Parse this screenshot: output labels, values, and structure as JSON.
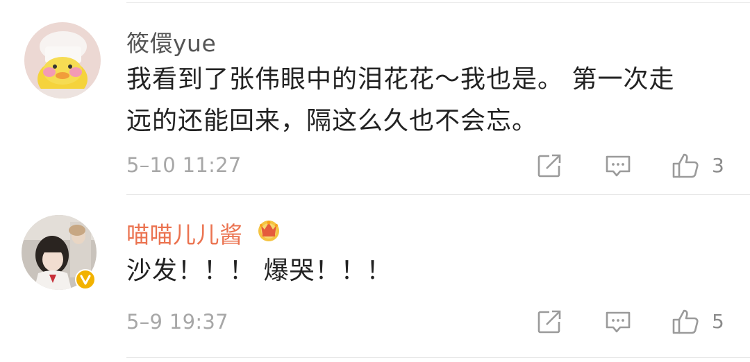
{
  "comments": [
    {
      "username": "筱儇yue",
      "avatar": "duck-with-chef-hat-avatar",
      "line1": "我看到了张伟眼中的泪花花～我也是。 第一次走",
      "line2": "远的还能回来，隔这么久也不会忘。",
      "timestamp": "5–10 11:27",
      "likes": "3",
      "icons": [
        "share-icon",
        "comment-icon",
        "like-icon"
      ]
    },
    {
      "username": "喵喵儿儿酱",
      "avatar": "girl-photo-avatar",
      "badges": [
        "crown-icon",
        "verified-icon"
      ],
      "line1": "沙发！！！ 爆哭！！！",
      "timestamp": "5–9 19:37",
      "likes": "5",
      "icons": [
        "share-icon",
        "comment-icon",
        "like-icon"
      ]
    }
  ],
  "colors": {
    "username_gray": "#555555",
    "username_vip": "#eb7350",
    "body_text": "#222222",
    "meta_text": "#a7a7a7",
    "icon": "#9a9a9a",
    "verified": "#f2b200"
  }
}
